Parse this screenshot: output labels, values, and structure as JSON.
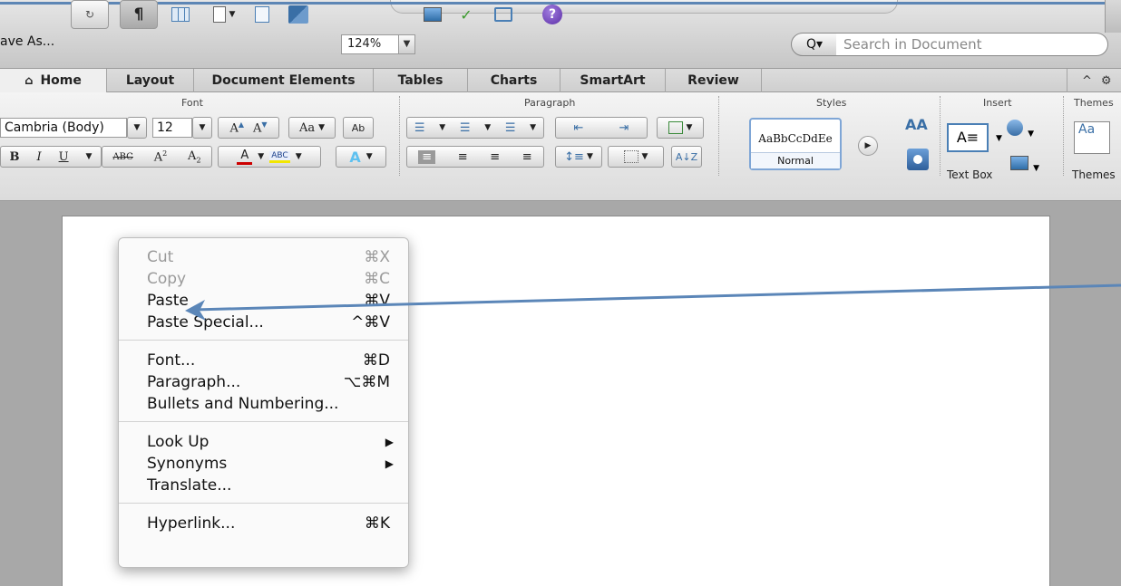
{
  "toolbar": {
    "save_as": "ave As...",
    "zoom": "124%",
    "search_placeholder": "Search in Document",
    "search_icon": "Q▾"
  },
  "tabs": [
    {
      "label": "Home",
      "icon": "home-icon"
    },
    {
      "label": "Layout"
    },
    {
      "label": "Document Elements"
    },
    {
      "label": "Tables"
    },
    {
      "label": "Charts"
    },
    {
      "label": "SmartArt"
    },
    {
      "label": "Review"
    }
  ],
  "ribbon": {
    "font_group": "Font",
    "paragraph_group": "Paragraph",
    "styles_group": "Styles",
    "insert_group": "Insert",
    "themes_group": "Themes",
    "font_name": "Cambria (Body)",
    "font_size": "12",
    "style_sample": "AaBbCcDdEe",
    "style_name": "Normal",
    "text_box": "Text Box",
    "themes_label": "Themes"
  },
  "menu": {
    "items": [
      {
        "label": "Cut",
        "shortcut": "⌘X",
        "enabled": false
      },
      {
        "label": "Copy",
        "shortcut": "⌘C",
        "enabled": false
      },
      {
        "label": "Paste",
        "shortcut": "⌘V",
        "enabled": true
      },
      {
        "label": "Paste Special...",
        "shortcut": "^⌘V",
        "enabled": true
      },
      {
        "label": "Font...",
        "shortcut": "⌘D",
        "enabled": true
      },
      {
        "label": "Paragraph...",
        "shortcut": "⌥⌘M",
        "enabled": true
      },
      {
        "label": "Bullets and Numbering...",
        "shortcut": "",
        "enabled": true
      },
      {
        "label": "Look Up",
        "submenu": true,
        "enabled": true
      },
      {
        "label": "Synonyms",
        "submenu": true,
        "enabled": true
      },
      {
        "label": "Translate...",
        "shortcut": "",
        "enabled": true
      },
      {
        "label": "Hyperlink...",
        "shortcut": "⌘K",
        "enabled": true
      }
    ]
  },
  "colors": {
    "arrow": "#5b86b8",
    "accent": "#7fa6d6"
  }
}
